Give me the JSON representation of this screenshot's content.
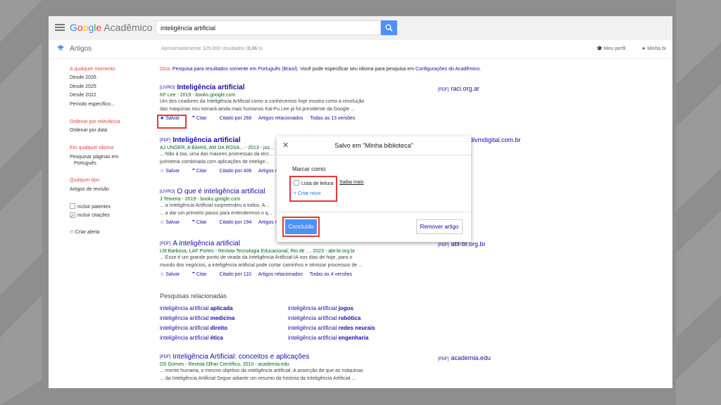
{
  "header": {
    "logo_google": "Google",
    "logo_app": "Acadêmico",
    "search_value": "inteligência artificial"
  },
  "subheader": {
    "section": "Artigos",
    "results_count": "Aproximadamente 325.000 resultados (0,06 s)",
    "profile": "Meu perfil",
    "library": "Minha bi"
  },
  "sidebar": {
    "time_any": "A qualquer momento",
    "since_2026": "Desde 2026",
    "since_2025": "Desde 2025",
    "since_2022": "Desde 2022",
    "period": "Período específico...",
    "sort_relevance": "Ordenar por relevância",
    "sort_date": "Ordenar por data",
    "lang_any": "Em qualquer idioma",
    "lang_pt_1": "Pesquisar páginas em",
    "lang_pt_2": "Português",
    "type_any": "Qualquer tipo",
    "type_review": "Artigos de revisão",
    "include_patents": "incluir patentes",
    "include_citations": "incluir citações",
    "create_alert": "Criar alerta"
  },
  "tip": {
    "prefix": "Dica:",
    "link1": "Pesquisa para resultados somente em Português (Brasil)",
    "middle": ". Você pode especificar seu idioma para pesquisa em",
    "link2": "Configurações do Acadêmico",
    "suffix": "."
  },
  "results": [
    {
      "tag": "[LIVRO]",
      "title": "Inteligência artificial",
      "meta": "KF Lee - 2019 - books.google.com",
      "snip1": "Um dos criadores da Inteligência Artificial como a conhecemos hoje mostra como a revolução",
      "snip2": "das máquinas nos tornará ainda mais humanos Kai-Fu Lee já foi presidente da Google ...",
      "save": "Salvar",
      "cite": "Citar",
      "cited": "Citado por 266",
      "related": "Artigos relacionados",
      "versions": "Todas as 13 versões",
      "side": "raci.org.ar",
      "side_tag": "[PDF]"
    },
    {
      "tag": "[PDF]",
      "title": "Inteligência artificial",
      "meta": "AJ UNGER, A BAHIA, AM DA ROSA... - 2013 - jus...",
      "snip1": "... Não à toa, uma das maiores promessas da tecr...",
      "snip2": "jurimetria combinada com aplicações de Intelige...",
      "save": "Salvar",
      "cite": "Citar",
      "cited": "Citado por 406",
      "related": "Artigos rela...",
      "side": "divmdigital.com.br"
    },
    {
      "tag": "[LIVRO]",
      "title": "O que é inteligência artificial",
      "meta": "J Teixeira - 2019 - books.google.com",
      "snip1": "... a Inteligência Artificial surpreendeu a todos. A...",
      "snip2": "... a dar um primeiro passo para entendermos o q...",
      "save": "Salvar",
      "cite": "Citar",
      "cited": "Citado por 194",
      "related": "Artigos rela..."
    },
    {
      "tag": "[PDF]",
      "title": "A inteligência artificial",
      "meta": "LM Barbosa, LAF Portes - Revista Tecnologia Educacional, Rio de ..., 2023 - abt-br.org.br",
      "snip1": "... Esse é um grande ponto de virada da Inteligência Artificial-IA nos dias de hoje, para o",
      "snip2": "mundo dos negócios, a inteligência artificial pode cortar caminhos e otimizar processos de ...",
      "save": "Salvar",
      "cite": "Citar",
      "cited": "Citado por 110",
      "related": "Artigos relacionados",
      "versions": "Todas as 4 versões",
      "side": "abt-br.org.br",
      "side_tag": "[PDF]"
    },
    {
      "tag": "[PDF]",
      "title": "Inteligência Artificial: conceitos e aplicações",
      "meta": "DS Gomes - Revista Olhar Científico, 2010 - academia.edu",
      "snip1": "... mente humana, o mesmo objetivo da inteligência artificial. A asserção de que as máquinas",
      "snip2": "... da Inteligência Artificial Segue adiante um resumo da história da Inteligência Artificial ...",
      "side": "academia.edu",
      "side_tag": "[PDF]"
    }
  ],
  "related": {
    "heading": "Pesquisas relacionadas",
    "base": "inteligência artificial",
    "items": [
      "aplicada",
      "medicina",
      "direito",
      "ética",
      "jogos",
      "robótica",
      "redes neurais",
      "engenharia"
    ]
  },
  "dialog": {
    "title": "Salvo em \"Minha biblioteca\"",
    "close": "✕",
    "label": "Marcar como:",
    "reading_list": "Lista de leitura",
    "learn_more": "Saiba mais",
    "create_new": "Criar novo",
    "done": "Concluído",
    "remove": "Remover artigo"
  },
  "colors": {
    "accent": "#4d90fe",
    "highlight_box": "#e53935",
    "link": "#1a0dab",
    "red_filter": "#dd4b39"
  }
}
